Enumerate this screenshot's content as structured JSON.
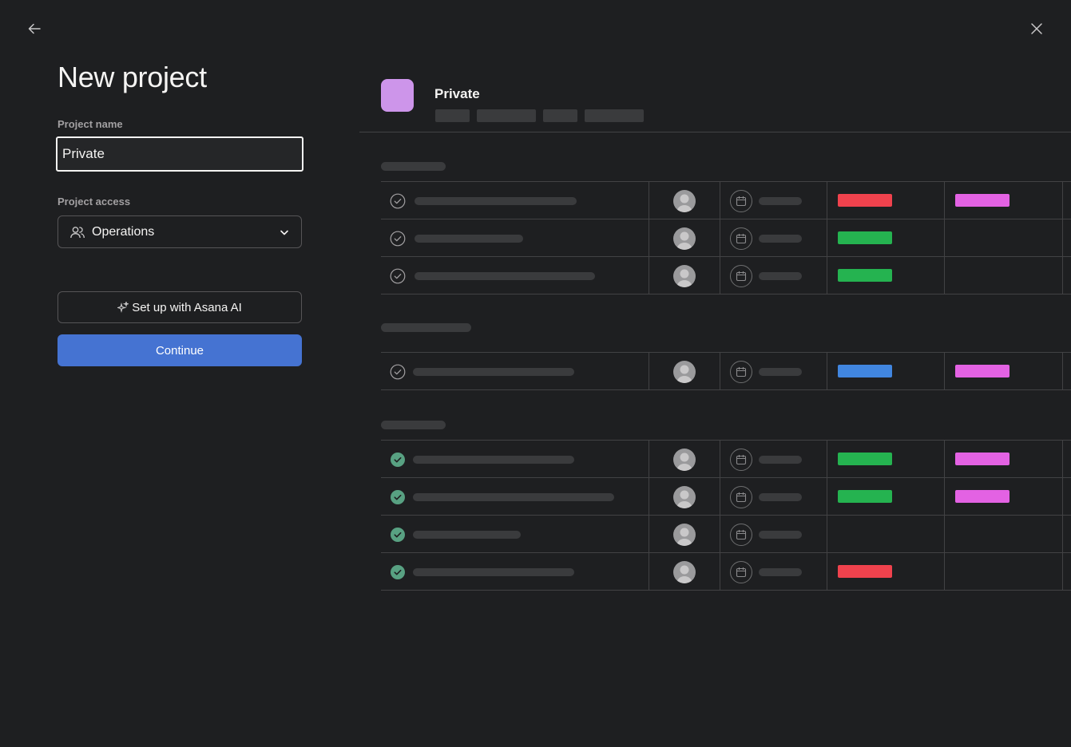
{
  "dialog": {
    "title": "New project",
    "back_icon": "arrow-left-icon",
    "close_icon": "close-icon"
  },
  "form": {
    "name_label": "Project name",
    "name_value": "Private",
    "access_label": "Project access",
    "access_value": "Operations",
    "access_icon": "team-icon",
    "ai_button_label": "Set up with Asana AI",
    "continue_label": "Continue"
  },
  "preview": {
    "project_title": "Private",
    "project_color": "#cd95ea",
    "sections": [
      {
        "rows": [
          {
            "done": false,
            "tag1": "#f0424d",
            "tag2": "#e362e3"
          },
          {
            "done": false,
            "tag1": "#25b350",
            "tag2": ""
          },
          {
            "done": false,
            "tag1": "#25b350",
            "tag2": ""
          }
        ]
      },
      {
        "rows": [
          {
            "done": false,
            "tag1": "#4186e0",
            "tag2": "#e362e3"
          }
        ]
      },
      {
        "rows": [
          {
            "done": true,
            "tag1": "#25b350",
            "tag2": "#e362e3"
          },
          {
            "done": true,
            "tag1": "#25b350",
            "tag2": "#e362e3"
          },
          {
            "done": true,
            "tag1": "",
            "tag2": ""
          },
          {
            "done": true,
            "tag1": "#f0424d",
            "tag2": ""
          }
        ]
      }
    ]
  }
}
